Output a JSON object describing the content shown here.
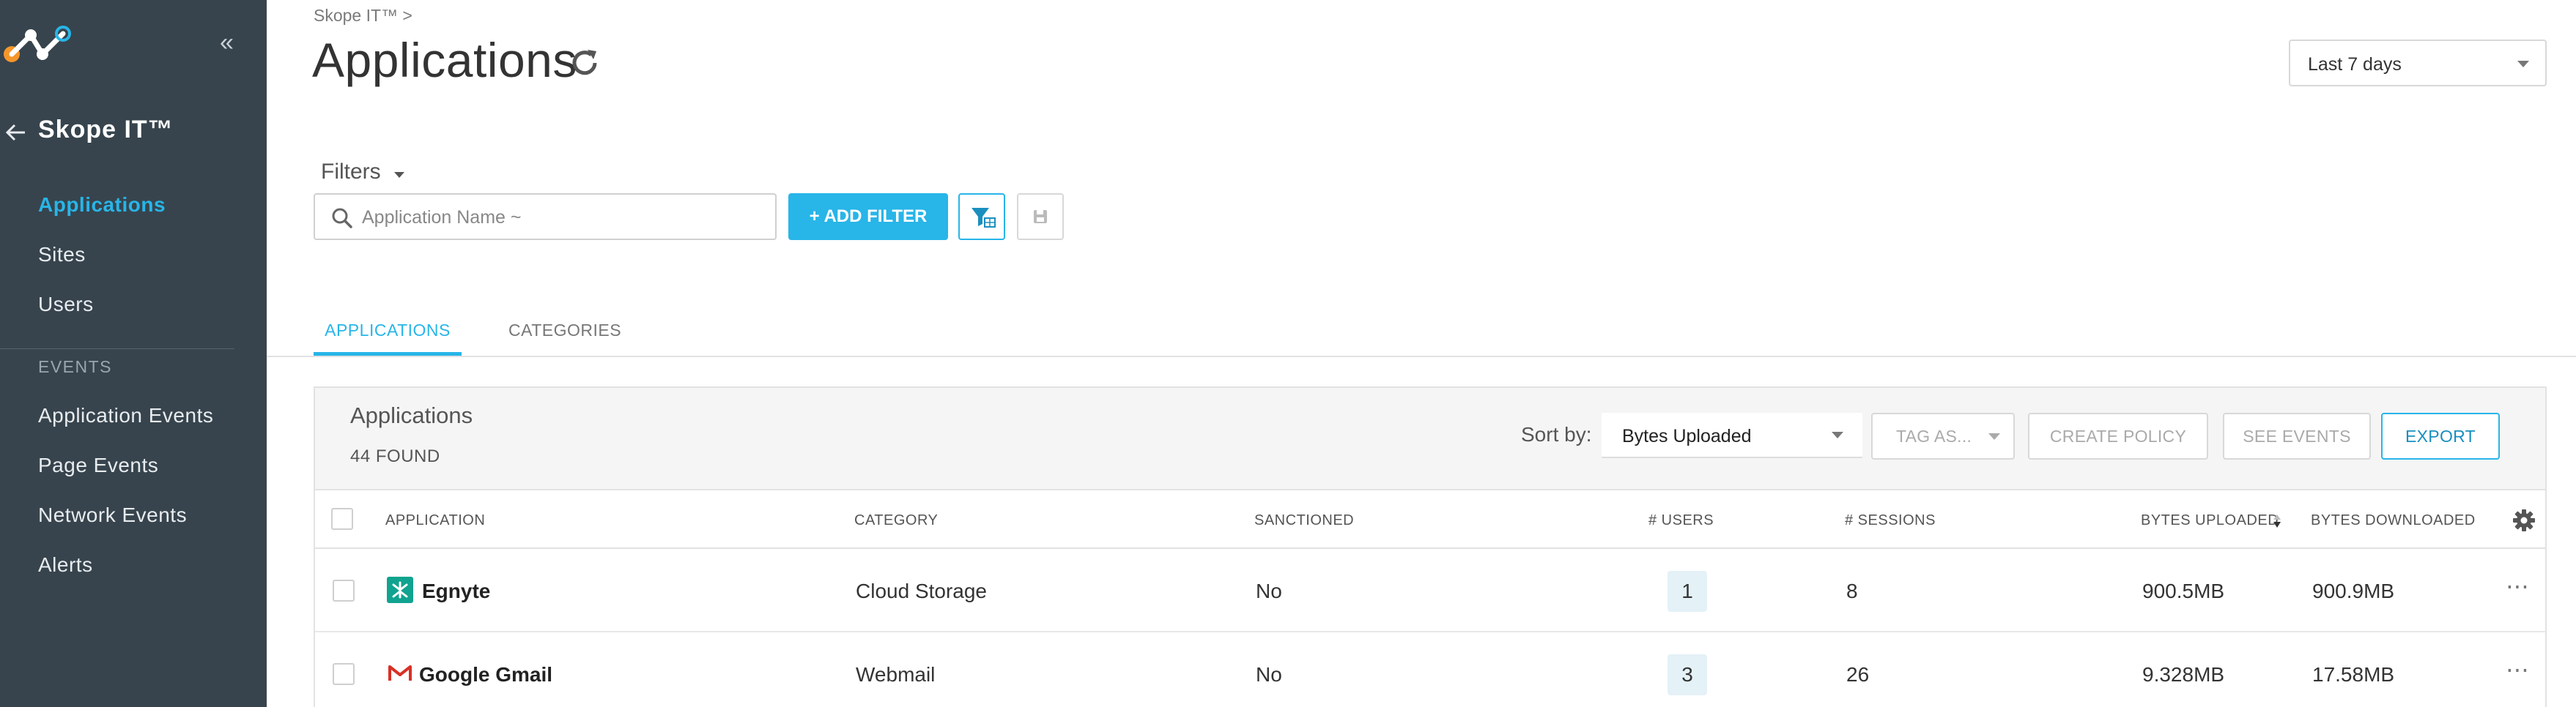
{
  "sidebar": {
    "app_title": "Skope IT™",
    "items": [
      {
        "label": "Applications"
      },
      {
        "label": "Sites"
      },
      {
        "label": "Users"
      }
    ],
    "section_label": "EVENTS",
    "event_items": [
      {
        "label": "Application Events"
      },
      {
        "label": "Page Events"
      },
      {
        "label": "Network Events"
      },
      {
        "label": "Alerts"
      }
    ]
  },
  "header": {
    "breadcrumb": "Skope IT™ >",
    "title": "Applications",
    "date_range": "Last 7 days"
  },
  "filters": {
    "label": "Filters",
    "search_placeholder": "Application Name ~",
    "add_filter_label": "+ ADD FILTER"
  },
  "tabs": [
    {
      "label": "APPLICATIONS",
      "active": true
    },
    {
      "label": "CATEGORIES",
      "active": false
    }
  ],
  "panel": {
    "title": "Applications",
    "count": "44 FOUND",
    "sort_label": "Sort by:",
    "sort_value": "Bytes Uploaded",
    "tag_label": "TAG AS...",
    "create_policy_label": "CREATE POLICY",
    "see_events_label": "SEE EVENTS",
    "export_label": "EXPORT"
  },
  "table": {
    "columns": {
      "application": "APPLICATION",
      "category": "CATEGORY",
      "sanctioned": "SANCTIONED",
      "users": "# USERS",
      "sessions": "# SESSIONS",
      "bytes_uploaded": "BYTES UPLOADED",
      "bytes_downloaded": "BYTES DOWNLOADED"
    },
    "rows": [
      {
        "application": "Egnyte",
        "icon": "egnyte-icon",
        "category": "Cloud Storage",
        "sanctioned": "No",
        "users": "1",
        "sessions": "8",
        "bytes_uploaded": "900.5MB",
        "bytes_downloaded": "900.9MB"
      },
      {
        "application": "Google Gmail",
        "icon": "gmail-icon",
        "category": "Webmail",
        "sanctioned": "No",
        "users": "3",
        "sessions": "26",
        "bytes_uploaded": "9.328MB",
        "bytes_downloaded": "17.58MB"
      }
    ]
  },
  "colors": {
    "accent": "#28b5e8",
    "sidebar_bg": "#37444d",
    "logo_orange": "#f5962a"
  }
}
